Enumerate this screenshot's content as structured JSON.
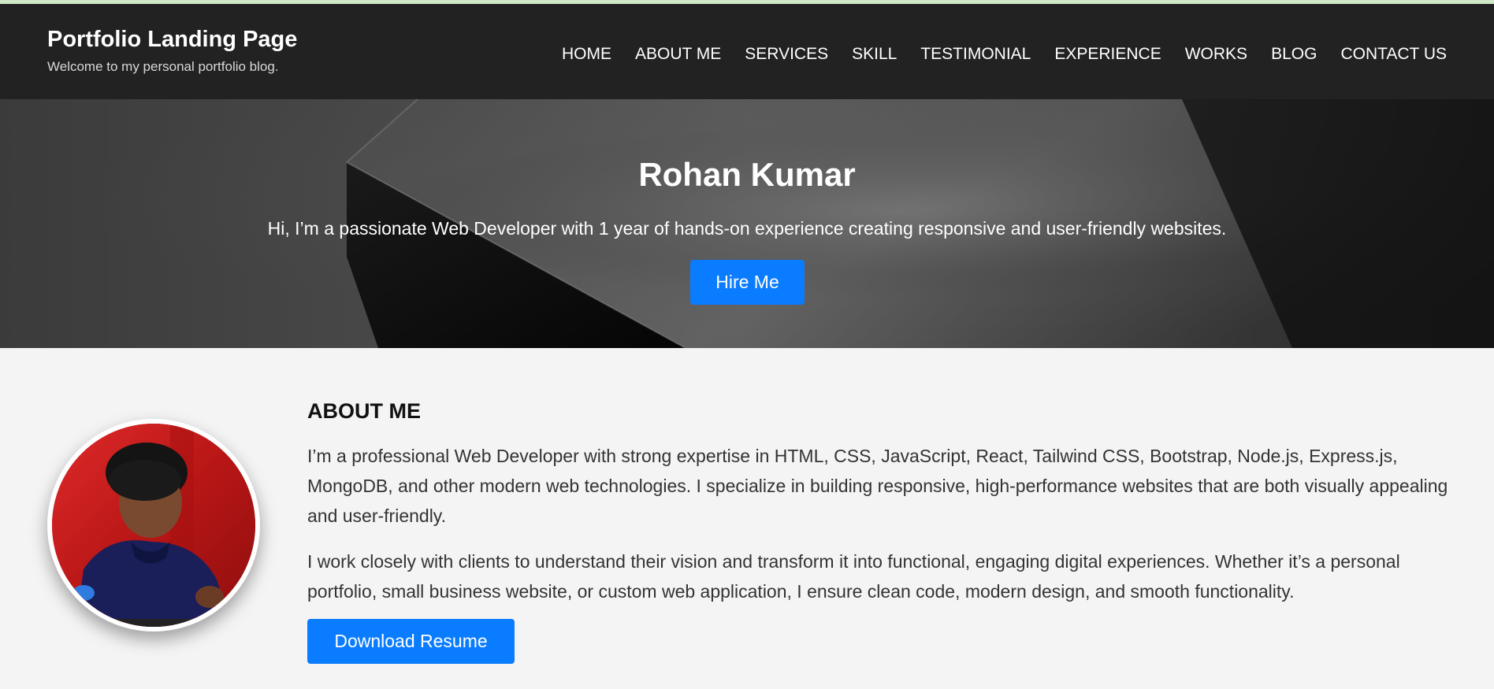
{
  "header": {
    "title": "Portfolio Landing Page",
    "tagline": "Welcome to my personal portfolio blog."
  },
  "nav": {
    "items": [
      {
        "label": "HOME"
      },
      {
        "label": "ABOUT ME"
      },
      {
        "label": "SERVICES"
      },
      {
        "label": "SKILL"
      },
      {
        "label": "TESTIMONIAL"
      },
      {
        "label": "EXPERIENCE"
      },
      {
        "label": "WORKS"
      },
      {
        "label": "BLOG"
      },
      {
        "label": "CONTACT US"
      }
    ]
  },
  "hero": {
    "name": "Rohan Kumar",
    "intro": "Hi, I’m a passionate Web Developer with 1 year of hands-on experience creating responsive and user-friendly websites.",
    "cta_label": "Hire Me"
  },
  "about": {
    "heading": "ABOUT ME",
    "paragraph1": "I’m a professional Web Developer with strong expertise in HTML, CSS, JavaScript, React, Tailwind CSS, Bootstrap, Node.js, Express.js, MongoDB, and other modern web technologies. I specialize in building responsive, high-performance websites that are both visually appealing and user-friendly.",
    "paragraph2": "I work closely with clients to understand their vision and transform it into functional, engaging digital experiences. Whether it’s a personal portfolio, small business website, or custom web application, I ensure clean code, modern design, and smooth functionality.",
    "resume_label": "Download Resume",
    "avatar_icon": "profile-photo"
  },
  "colors": {
    "header_bg": "#222222",
    "accent": "#0a7cff",
    "page_bg": "#f4f4f4",
    "top_strip": "#cfe8c8"
  }
}
